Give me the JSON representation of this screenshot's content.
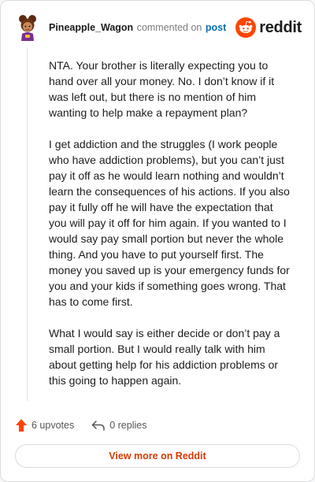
{
  "header": {
    "username": "Pineapple_Wagon",
    "action_text": "commented on",
    "post_link": "post",
    "brand": "reddit"
  },
  "comment": {
    "paragraphs": [
      "NTA. Your brother is literally expecting you to hand over all your money. No. I don’t know if it was left out, but there is no mention of him wanting to help make a repayment plan?",
      "I get addiction and the struggles (I work people who have addiction problems), but you can’t just pay it off as he would learn nothing and wouldn’t learn the consequences of his actions. If you also pay it fully off he will have the expectation that you will pay it off for him again. If you wanted to I would say pay small portion but never the whole thing. And you have to put yourself first. The money you saved up is your emergency funds for you and your kids if something goes wrong. That has to come first.",
      "What I would say is either decide or don’t pay a small portion. But I would really talk with him about getting help for his addiction problems or this going to happen again."
    ]
  },
  "footer": {
    "upvotes": "6 upvotes",
    "replies": "0 replies",
    "view_more": "View more on Reddit"
  },
  "colors": {
    "accent": "#ff4500",
    "link": "#0b6ea8",
    "view_more_text": "#d93a00"
  },
  "icons": {
    "upvote": "upvote-arrow-icon",
    "reply": "reply-arrow-icon",
    "logo": "reddit-snoo-icon"
  }
}
